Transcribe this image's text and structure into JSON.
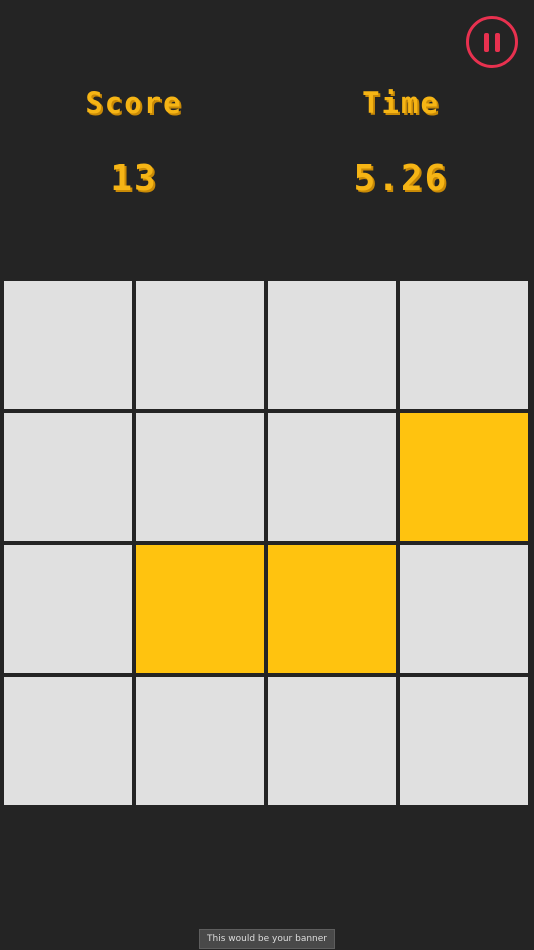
{
  "hud": {
    "score_label": "Score",
    "score_value": "13",
    "time_label": "Time",
    "time_value": "5.26",
    "pause_icon": "pause-icon"
  },
  "board": {
    "rows": 4,
    "cols": 4,
    "tiles": [
      [
        0,
        0,
        0,
        0
      ],
      [
        0,
        0,
        0,
        1
      ],
      [
        0,
        1,
        1,
        0
      ],
      [
        0,
        0,
        0,
        0
      ]
    ]
  },
  "banner": {
    "text": "This would be your banner"
  },
  "colors": {
    "background": "#242424",
    "tile_empty": "#e0e0e0",
    "tile_active": "#ffc30f",
    "hud_text": "#f6b515",
    "pause_accent": "#e8314f"
  }
}
